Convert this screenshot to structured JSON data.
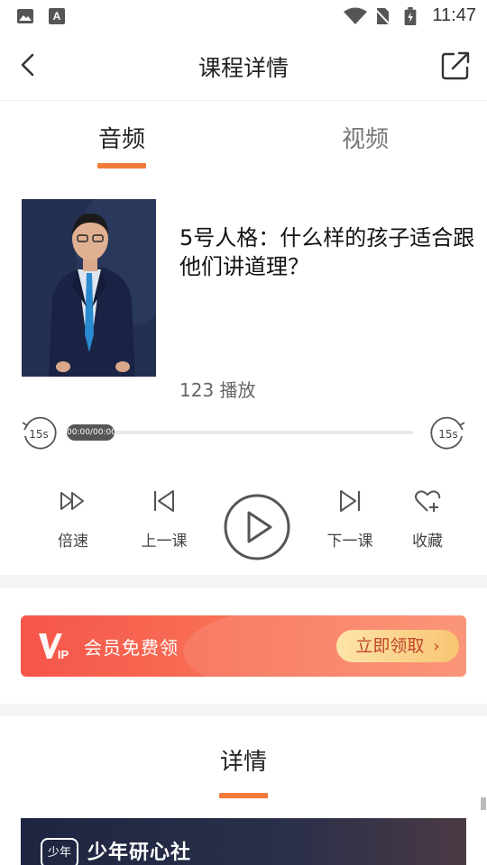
{
  "status_bar": {
    "time": "11:47",
    "icons": [
      "image-icon",
      "font-icon",
      "wifi-icon",
      "no-sim-icon",
      "battery-charging-icon"
    ]
  },
  "header": {
    "title": "课程详情",
    "back_icon": "chevron-left-icon",
    "share_icon": "share-icon"
  },
  "tabs": [
    {
      "label": "音频",
      "active": true
    },
    {
      "label": "视频",
      "active": false
    }
  ],
  "course": {
    "title": "5号人格：什么样的孩子适合跟他们讲道理？",
    "plays": "123 播放"
  },
  "player": {
    "skip_back_label": "15s",
    "skip_forward_label": "15s",
    "time": "00:00/00:00",
    "progress": 0,
    "controls": [
      {
        "label": "倍速",
        "icon": "speed-icon"
      },
      {
        "label": "上一课",
        "icon": "previous-icon"
      },
      {
        "label": "下一课",
        "icon": "next-icon"
      },
      {
        "label": "收藏",
        "icon": "favorite-add-icon"
      }
    ]
  },
  "vip_banner": {
    "logo": "VIP",
    "text": "会员免费领",
    "cta": "立即领取"
  },
  "details": {
    "title": "详情",
    "banner_logo": "少年",
    "banner_text": "少年研心社"
  },
  "colors": {
    "accent": "#f37a38",
    "vip_start": "#f5554a",
    "vip_end": "#fb8a6a",
    "cta_text": "#c0442c"
  }
}
